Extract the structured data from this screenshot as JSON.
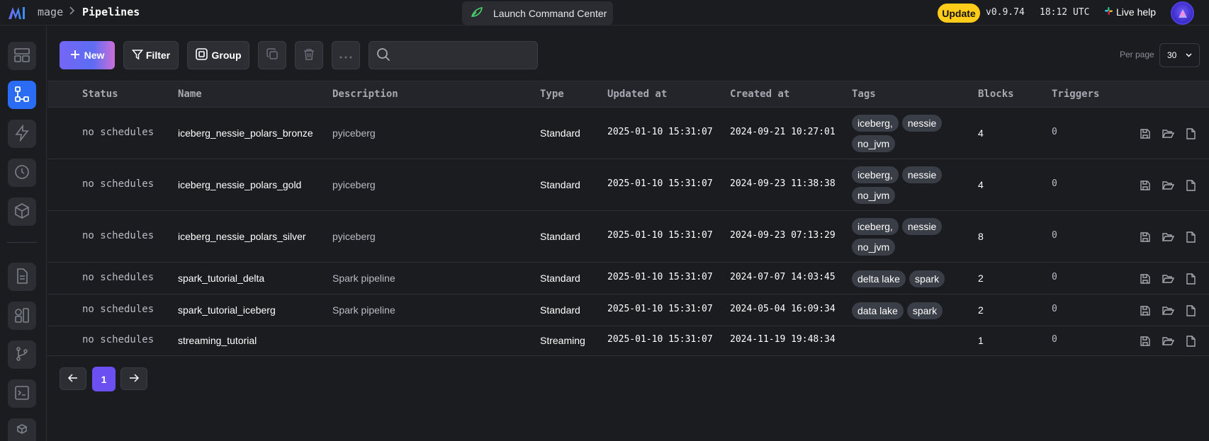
{
  "header": {
    "brand": "mage",
    "page_title": "Pipelines",
    "command_center": "Launch Command Center",
    "update_label": "Update",
    "version": "v0.9.74",
    "time": "18:12 UTC",
    "live_help": "Live help"
  },
  "sidebar": {
    "items": [
      {
        "icon": "dashboard-icon",
        "active": false
      },
      {
        "icon": "pipelines-icon",
        "active": true
      },
      {
        "icon": "triggers-icon",
        "active": false
      },
      {
        "icon": "schedule-icon",
        "active": false
      },
      {
        "icon": "global-data-products-icon",
        "active": false
      },
      {
        "icon": "files-icon",
        "active": false
      },
      {
        "icon": "templates-icon",
        "active": false
      },
      {
        "icon": "version-control-icon",
        "active": false
      },
      {
        "icon": "terminal-icon",
        "active": false
      },
      {
        "icon": "settings-icon",
        "active": false
      }
    ]
  },
  "toolbar": {
    "new_label": "New",
    "filter_label": "Filter",
    "group_label": "Group",
    "search_placeholder": "",
    "per_page_label": "Per page",
    "per_page_value": "30"
  },
  "table": {
    "headers": [
      "Status",
      "Name",
      "Description",
      "Type",
      "Updated at",
      "Created at",
      "Tags",
      "Blocks",
      "Triggers"
    ],
    "rows": [
      {
        "status": "no schedules",
        "name": "iceberg_nessie_polars_bronze",
        "description": "pyiceberg",
        "type": "Standard",
        "updated_at": "2025-01-10 15:31:07",
        "created_at": "2024-09-21 10:27:01",
        "tags": [
          "iceberg,",
          "nessie",
          "no_jvm"
        ],
        "blocks": "4",
        "triggers": "0"
      },
      {
        "status": "no schedules",
        "name": "iceberg_nessie_polars_gold",
        "description": "pyiceberg",
        "type": "Standard",
        "updated_at": "2025-01-10 15:31:07",
        "created_at": "2024-09-23 11:38:38",
        "tags": [
          "iceberg,",
          "nessie",
          "no_jvm"
        ],
        "blocks": "4",
        "triggers": "0"
      },
      {
        "status": "no schedules",
        "name": "iceberg_nessie_polars_silver",
        "description": "pyiceberg",
        "type": "Standard",
        "updated_at": "2025-01-10 15:31:07",
        "created_at": "2024-09-23 07:13:29",
        "tags": [
          "iceberg,",
          "nessie",
          "no_jvm"
        ],
        "blocks": "8",
        "triggers": "0"
      },
      {
        "status": "no schedules",
        "name": "spark_tutorial_delta",
        "description": "Spark pipeline",
        "type": "Standard",
        "updated_at": "2025-01-10 15:31:07",
        "created_at": "2024-07-07 14:03:45",
        "tags": [
          "delta lake",
          "spark"
        ],
        "blocks": "2",
        "triggers": "0"
      },
      {
        "status": "no schedules",
        "name": "spark_tutorial_iceberg",
        "description": "Spark pipeline",
        "type": "Standard",
        "updated_at": "2025-01-10 15:31:07",
        "created_at": "2024-05-04 16:09:34",
        "tags": [
          "data lake",
          "spark"
        ],
        "blocks": "2",
        "triggers": "0"
      },
      {
        "status": "no schedules",
        "name": "streaming_tutorial",
        "description": "",
        "type": "Streaming",
        "updated_at": "2025-01-10 15:31:07",
        "created_at": "2024-11-19 19:48:34",
        "tags": [],
        "blocks": "1",
        "triggers": "0"
      }
    ]
  },
  "pagination": {
    "current_page": "1"
  },
  "colors": {
    "accent": "#2a6df4",
    "update": "#ffcc19",
    "current_page": "#6b4ff0"
  }
}
